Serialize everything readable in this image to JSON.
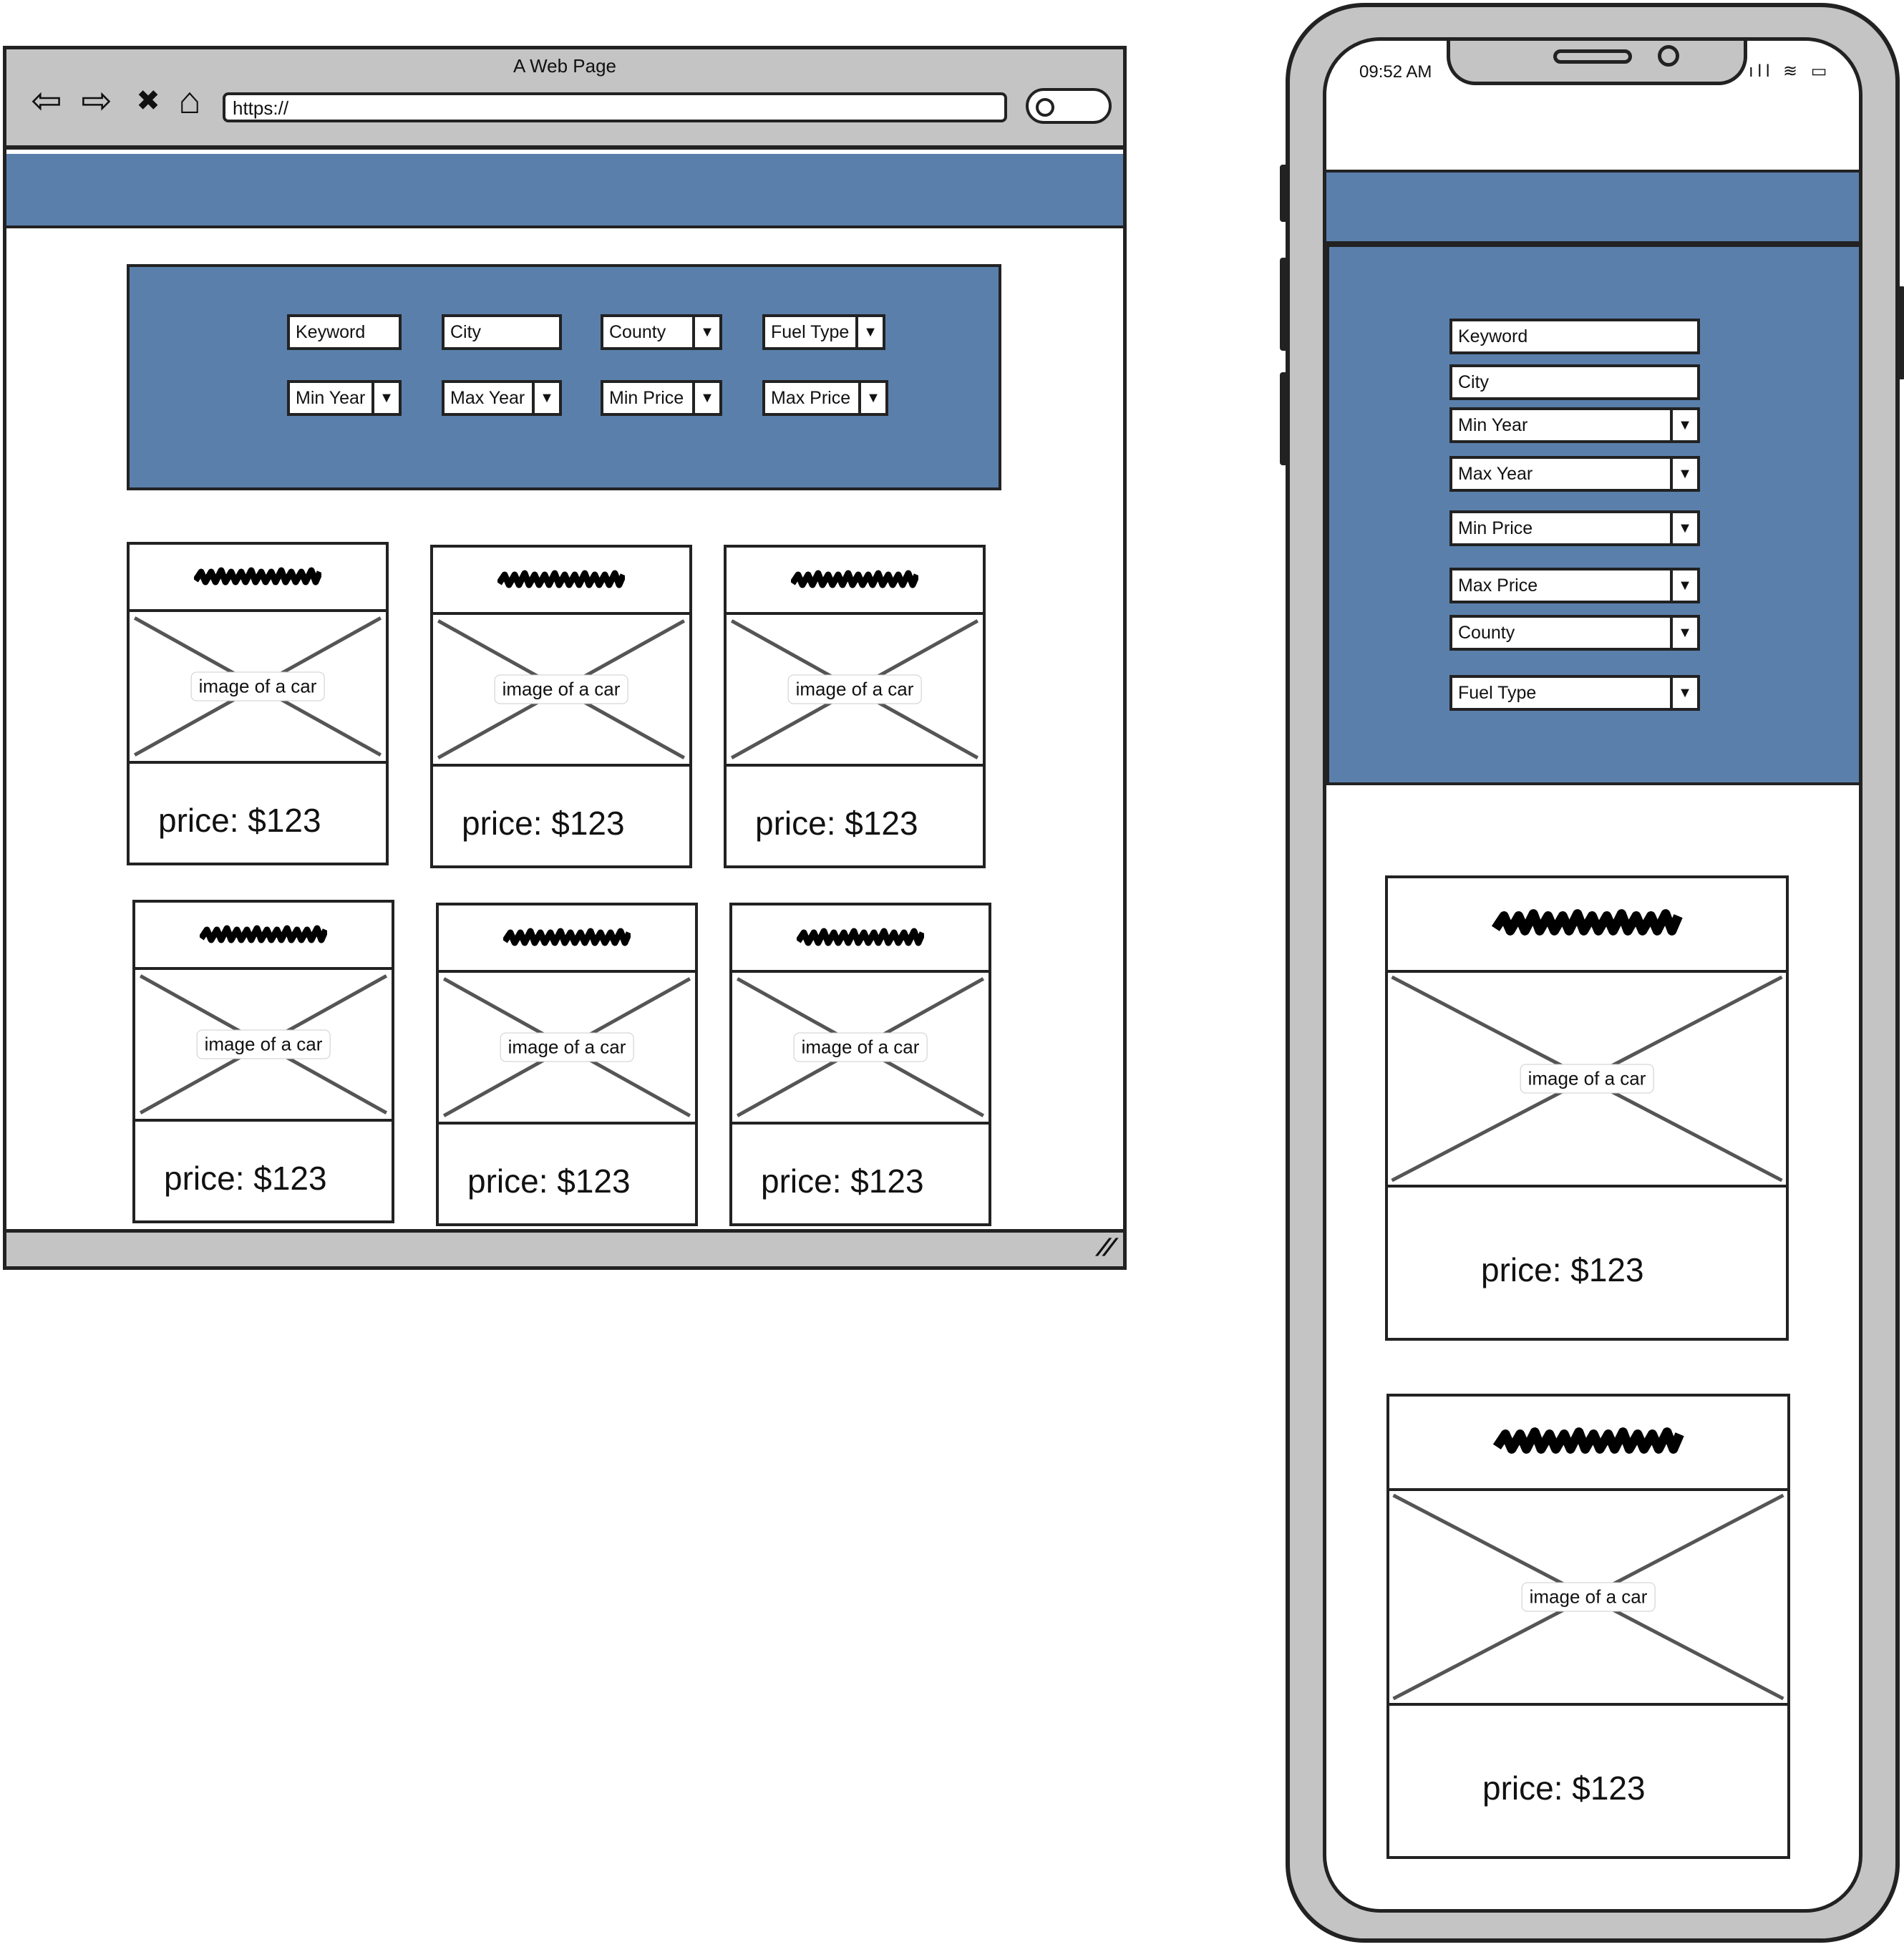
{
  "browser": {
    "title": "A Web Page",
    "url": "https://",
    "nav": {
      "back_icon": "⇦",
      "forward_icon": "⇨",
      "close_icon": "✖",
      "home_icon": "⌂"
    }
  },
  "filters": {
    "keyword": "Keyword",
    "city": "City",
    "county": "County",
    "fuel_type": "Fuel Type",
    "min_year": "Min Year",
    "max_year": "Max Year",
    "min_price": "Min Price",
    "max_price": "Max Price"
  },
  "cards": [
    {
      "image_label": "image of a car",
      "price": "price: $123"
    },
    {
      "image_label": "image of a car",
      "price": "price: $123"
    },
    {
      "image_label": "image of a car",
      "price": "price: $123"
    },
    {
      "image_label": "image of a car",
      "price": "price: $123"
    },
    {
      "image_label": "image of a car",
      "price": "price: $123"
    },
    {
      "image_label": "image of a car",
      "price": "price: $123"
    }
  ],
  "phone": {
    "time": "09:52 AM",
    "status_icons": "ıll ≋ ▭",
    "cards": [
      {
        "image_label": "image of a car",
        "price": "price: $123"
      },
      {
        "image_label": "image of a car",
        "price": "price: $123"
      }
    ]
  },
  "colors": {
    "header_blue": "#5a7fab",
    "chrome_gray": "#c4c4c4",
    "line": "#222222"
  },
  "icons": {
    "dropdown_arrow": "▼",
    "resize_grip": "//"
  }
}
